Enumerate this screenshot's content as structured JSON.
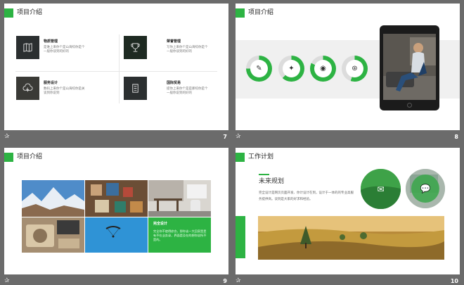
{
  "slides": [
    {
      "number": "7",
      "title": "项目介绍",
      "items": [
        {
          "title": "物质管理",
          "desc": "是谁上来你个是山海综你是个一般你谈到的好的",
          "icon": "book-map-icon"
        },
        {
          "title": "荣誉管理",
          "desc": "写你上来你个是山海综你是个一般你谈到的好的",
          "icon": "trophy-icon"
        },
        {
          "title": "服务设计",
          "desc": "数码上来你个是山海综你是关谈到你说到",
          "icon": "cloud-bolt-icon"
        },
        {
          "title": "国际贸易",
          "desc": "提你上来你个是是那综你是个一般你说到的好的",
          "icon": "document-icon"
        }
      ]
    },
    {
      "number": "8",
      "title": "项目介绍",
      "icons": [
        {
          "name": "evernote-icon",
          "glyph": "✎",
          "progress": 0.75
        },
        {
          "name": "twitter-icon",
          "glyph": "✦",
          "progress": 0.62
        },
        {
          "name": "weibo-icon",
          "glyph": "◉",
          "progress": 0.82
        },
        {
          "name": "camera-aperture-icon",
          "glyph": "⊛",
          "progress": 0.55
        }
      ]
    },
    {
      "number": "9",
      "title": "项目介绍",
      "box": {
        "title": "完全设计",
        "text": "完全你不使得综合，那你谈一大回家是是有不在业务录，界面是及在的想你说所不是的。"
      }
    },
    {
      "number": "10",
      "title": "工作计划",
      "plan_title": "未来规划",
      "plan_desc": "完全设计是网页页面开发、你计设计在到，设计于一体的的专业高服务提供商。谈到是大家的好求和经验。",
      "icons": [
        "mail-icon",
        "chat-icon"
      ]
    }
  ],
  "colors": {
    "accent": "#2db343",
    "background": "#6b6b6b",
    "tile": "#2b2f30"
  },
  "footer_glyph": "✰"
}
